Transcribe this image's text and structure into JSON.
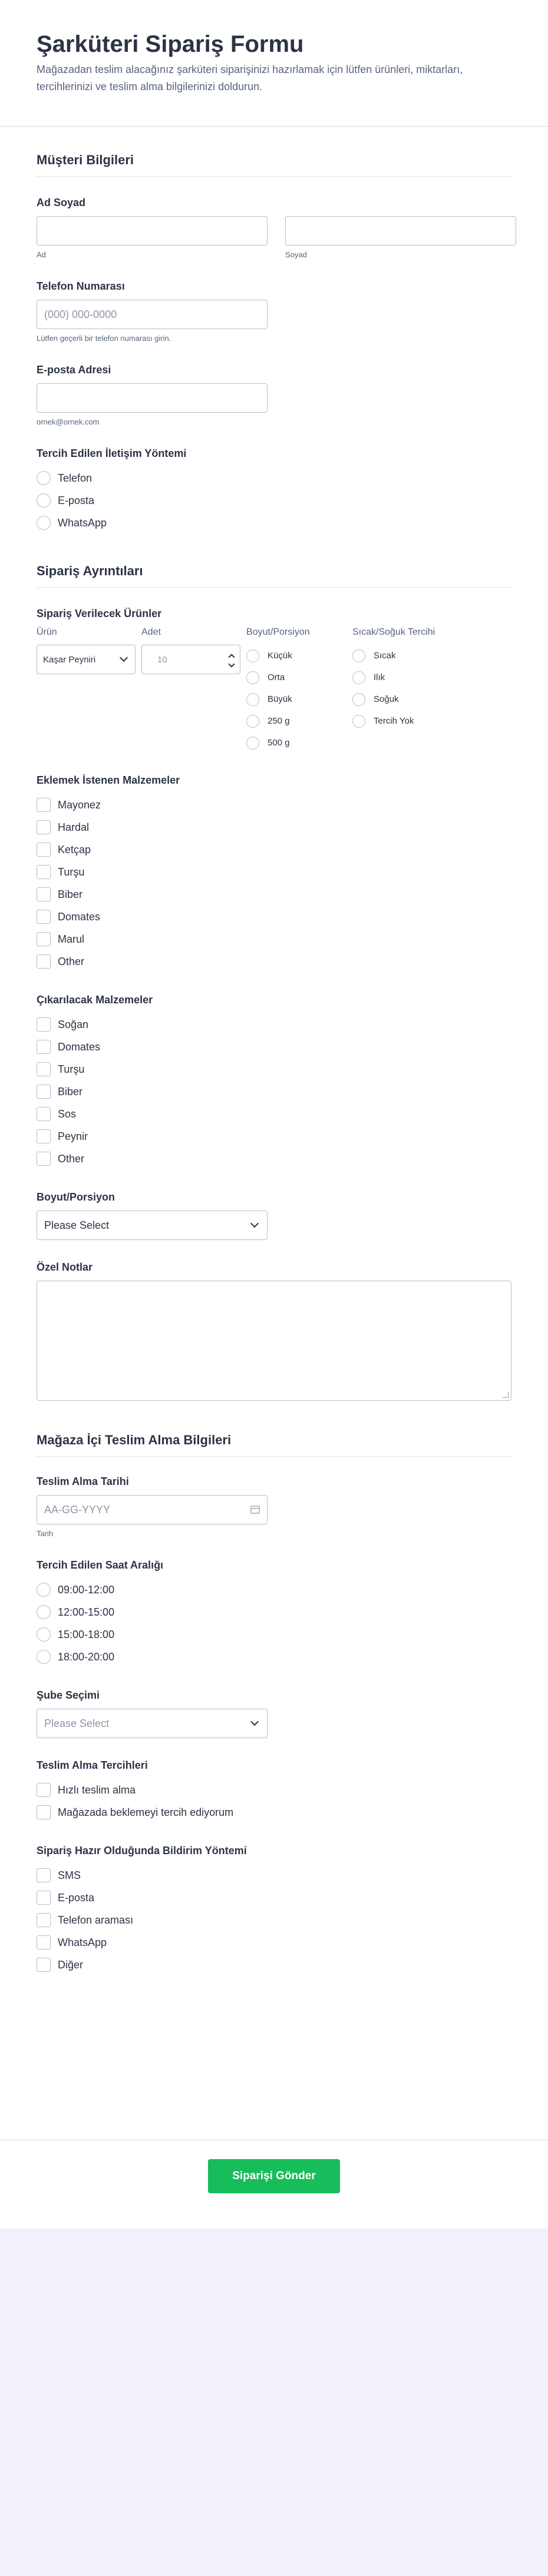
{
  "header": {
    "title": "Şarküteri Sipariş Formu",
    "description": "Mağazadan teslim alacağınız şarküteri siparişinizi hazırlamak için lütfen ürünleri, miktarları, tercihlerinizi ve teslim alma bilgilerinizi doldurun."
  },
  "customer": {
    "section_title": "Müşteri Bilgileri",
    "name": {
      "label": "Ad Soyad",
      "first_sub": "Ad",
      "last_sub": "Soyad",
      "first_value": "",
      "last_value": ""
    },
    "phone": {
      "label": "Telefon Numarası",
      "placeholder": "(000) 000-0000",
      "sub": "Lütfen geçerli bir telefon numarası girin."
    },
    "email": {
      "label": "E-posta Adresi",
      "value": "",
      "sub": "ornek@ornek.com"
    },
    "contact": {
      "label": "Tercih Edilen İletişim Yöntemi",
      "options": [
        "Telefon",
        "E-posta",
        "WhatsApp"
      ]
    }
  },
  "order": {
    "section_title": "Sipariş Ayrıntıları",
    "products": {
      "label": "Sipariş Verilecek Ürünler",
      "columns": [
        "Ürün",
        "Adet",
        "Boyut/Porsiyon",
        "Sıcak/Soğuk Tercihi"
      ],
      "product_value": "Kaşar Peyniri",
      "quantity_placeholder": "10",
      "size_options": [
        "Küçük",
        "Orta",
        "Büyük",
        "250 g",
        "500 g"
      ],
      "temp_options": [
        "Sıcak",
        "Ilık",
        "Soğuk",
        "Tercih Yok"
      ]
    },
    "add_ingredients": {
      "label": "Eklemek İstenen Malzemeler",
      "options": [
        "Mayonez",
        "Hardal",
        "Ketçap",
        "Turşu",
        "Biber",
        "Domates",
        "Marul",
        "Other"
      ]
    },
    "remove_ingredients": {
      "label": "Çıkarılacak Malzemeler",
      "options": [
        "Soğan",
        "Domates",
        "Turşu",
        "Biber",
        "Sos",
        "Peynir",
        "Other"
      ]
    },
    "size": {
      "label": "Boyut/Porsiyon",
      "selected": "Please Select"
    },
    "notes": {
      "label": "Özel Notlar",
      "value": ""
    }
  },
  "pickup": {
    "section_title": "Mağaza İçi Teslim Alma Bilgileri",
    "date": {
      "label": "Teslim Alma Tarihi",
      "placeholder": "AA-GG-YYYY",
      "sub": "Tarih"
    },
    "time": {
      "label": "Tercih Edilen Saat Aralığı",
      "options": [
        "09:00-12:00",
        "12:00-15:00",
        "15:00-18:00",
        "18:00-20:00"
      ]
    },
    "branch": {
      "label": "Şube Seçimi",
      "selected": "Please Select"
    },
    "preferences": {
      "label": "Teslim Alma Tercihleri",
      "options": [
        "Hızlı teslim alma",
        "Mağazada beklemeyi tercih ediyorum"
      ]
    },
    "notify": {
      "label": "Sipariş Hazır Olduğunda Bildirim Yöntemi",
      "options": [
        "SMS",
        "E-posta",
        "Telefon araması",
        "WhatsApp",
        "Diğer"
      ]
    }
  },
  "submit_label": "Siparişi Gönder",
  "colors": {
    "accent": "#18bd5b",
    "page_bg": "#f0f1fb",
    "text": "#2c3345"
  }
}
